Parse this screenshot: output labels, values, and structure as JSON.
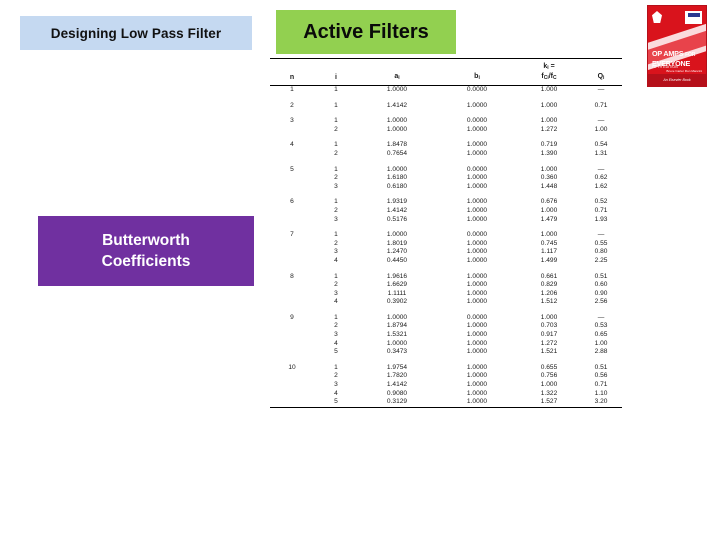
{
  "slide": {
    "topic_chip": "Designing Low Pass Filter",
    "subtopic_chip_line1": "Butterworth",
    "subtopic_chip_line2": "Coefficients",
    "section_title": "Active Filters"
  },
  "colors": {
    "topic_chip_bg": "#C5D9F1",
    "subtopic_chip_bg": "#7030A0",
    "section_title_bg": "#92D050",
    "book_red": "#D9131C",
    "text_dark": "#111111",
    "text_light": "#FFFFFF"
  },
  "book": {
    "title_main": "OP AMPS",
    "title_for": "FOR",
    "title_everyone": "EVERYONE",
    "edition": "FIFTH EDITION",
    "authors": "Bruce Carter\nRon Mancini",
    "footer": "An Elsevier Book"
  },
  "table": {
    "headers": {
      "n": "n",
      "i": "i",
      "a": "a",
      "a_sub": "i",
      "b": "b",
      "b_sub": "i",
      "k_top": "k",
      "k_top_sub": "i",
      "k_eq": "=",
      "k_num": "f",
      "k_num_sub": "Ci",
      "k_den": "f",
      "k_den_sub": "C",
      "q": "Q",
      "q_sub": "i"
    },
    "groups": [
      {
        "n": "1",
        "rows": [
          {
            "i": "1",
            "a": "1.0000",
            "b": "0.0000",
            "k": "1.000",
            "q": "—"
          }
        ]
      },
      {
        "n": "2",
        "rows": [
          {
            "i": "1",
            "a": "1.4142",
            "b": "1.0000",
            "k": "1.000",
            "q": "0.71"
          }
        ]
      },
      {
        "n": "3",
        "rows": [
          {
            "i": "1",
            "a": "1.0000",
            "b": "0.0000",
            "k": "1.000",
            "q": "—"
          },
          {
            "i": "2",
            "a": "1.0000",
            "b": "1.0000",
            "k": "1.272",
            "q": "1.00"
          }
        ]
      },
      {
        "n": "4",
        "rows": [
          {
            "i": "1",
            "a": "1.8478",
            "b": "1.0000",
            "k": "0.719",
            "q": "0.54"
          },
          {
            "i": "2",
            "a": "0.7654",
            "b": "1.0000",
            "k": "1.390",
            "q": "1.31"
          }
        ]
      },
      {
        "n": "5",
        "rows": [
          {
            "i": "1",
            "a": "1.0000",
            "b": "0.0000",
            "k": "1.000",
            "q": "—"
          },
          {
            "i": "2",
            "a": "1.6180",
            "b": "1.0000",
            "k": "0.360",
            "q": "0.62"
          },
          {
            "i": "3",
            "a": "0.6180",
            "b": "1.0000",
            "k": "1.448",
            "q": "1.62"
          }
        ]
      },
      {
        "n": "6",
        "rows": [
          {
            "i": "1",
            "a": "1.9319",
            "b": "1.0000",
            "k": "0.676",
            "q": "0.52"
          },
          {
            "i": "2",
            "a": "1.4142",
            "b": "1.0000",
            "k": "1.000",
            "q": "0.71"
          },
          {
            "i": "3",
            "a": "0.5176",
            "b": "1.0000",
            "k": "1.479",
            "q": "1.93"
          }
        ]
      },
      {
        "n": "7",
        "rows": [
          {
            "i": "1",
            "a": "1.0000",
            "b": "0.0000",
            "k": "1.000",
            "q": "—"
          },
          {
            "i": "2",
            "a": "1.8019",
            "b": "1.0000",
            "k": "0.745",
            "q": "0.55"
          },
          {
            "i": "3",
            "a": "1.2470",
            "b": "1.0000",
            "k": "1.117",
            "q": "0.80"
          },
          {
            "i": "4",
            "a": "0.4450",
            "b": "1.0000",
            "k": "1.499",
            "q": "2.25"
          }
        ]
      },
      {
        "n": "8",
        "rows": [
          {
            "i": "1",
            "a": "1.9616",
            "b": "1.0000",
            "k": "0.661",
            "q": "0.51"
          },
          {
            "i": "2",
            "a": "1.6629",
            "b": "1.0000",
            "k": "0.829",
            "q": "0.60"
          },
          {
            "i": "3",
            "a": "1.1111",
            "b": "1.0000",
            "k": "1.206",
            "q": "0.90"
          },
          {
            "i": "4",
            "a": "0.3902",
            "b": "1.0000",
            "k": "1.512",
            "q": "2.56"
          }
        ]
      },
      {
        "n": "9",
        "rows": [
          {
            "i": "1",
            "a": "1.0000",
            "b": "0.0000",
            "k": "1.000",
            "q": "—"
          },
          {
            "i": "2",
            "a": "1.8794",
            "b": "1.0000",
            "k": "0.703",
            "q": "0.53"
          },
          {
            "i": "3",
            "a": "1.5321",
            "b": "1.0000",
            "k": "0.917",
            "q": "0.65"
          },
          {
            "i": "4",
            "a": "1.0000",
            "b": "1.0000",
            "k": "1.272",
            "q": "1.00"
          },
          {
            "i": "5",
            "a": "0.3473",
            "b": "1.0000",
            "k": "1.521",
            "q": "2.88"
          }
        ]
      },
      {
        "n": "10",
        "rows": [
          {
            "i": "1",
            "a": "1.9754",
            "b": "1.0000",
            "k": "0.655",
            "q": "0.51"
          },
          {
            "i": "2",
            "a": "1.7820",
            "b": "1.0000",
            "k": "0.756",
            "q": "0.56"
          },
          {
            "i": "3",
            "a": "1.4142",
            "b": "1.0000",
            "k": "1.000",
            "q": "0.71"
          },
          {
            "i": "4",
            "a": "0.9080",
            "b": "1.0000",
            "k": "1.322",
            "q": "1.10"
          },
          {
            "i": "5",
            "a": "0.3129",
            "b": "1.0000",
            "k": "1.527",
            "q": "3.20"
          }
        ]
      }
    ]
  }
}
